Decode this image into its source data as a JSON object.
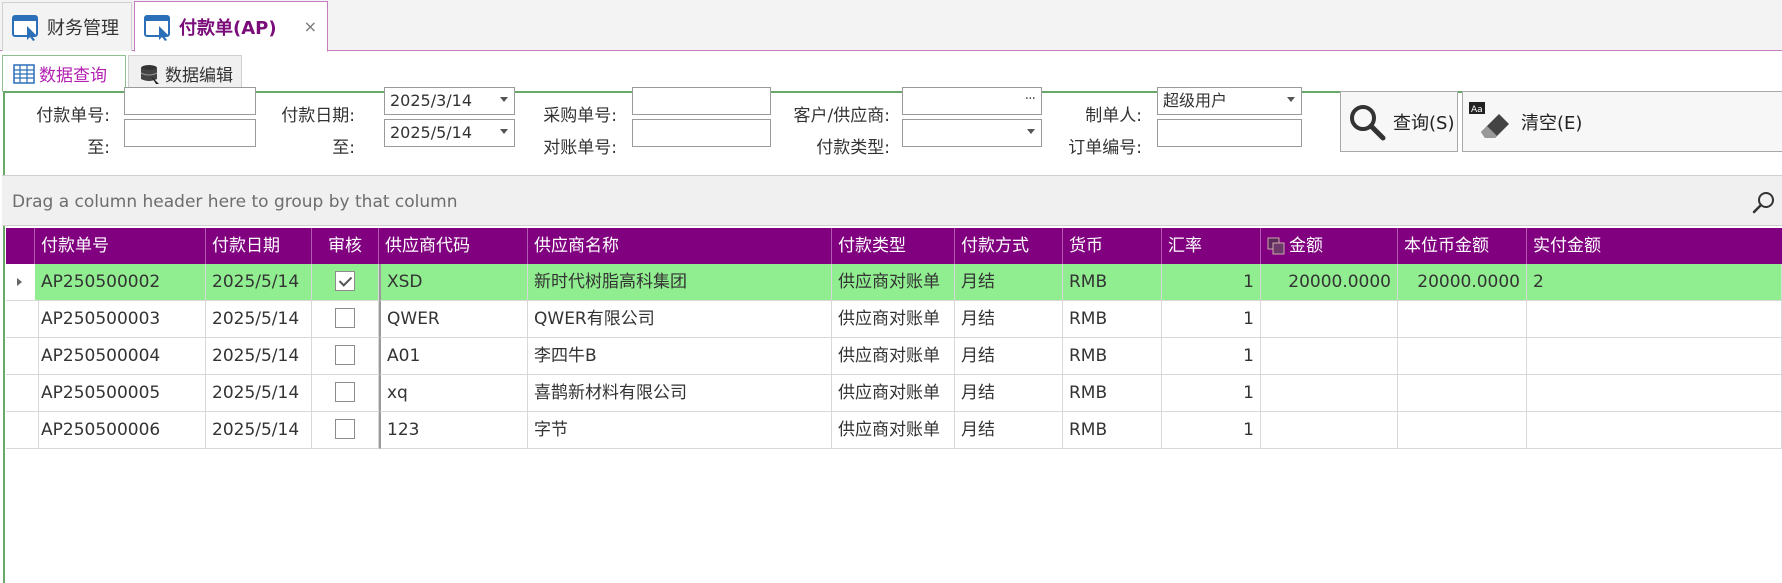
{
  "doc_tabs": [
    {
      "label": "财务管理",
      "icon": "window-pointer-icon"
    },
    {
      "label": "付款单(AP)",
      "icon": "window-pointer-icon",
      "close": "×"
    }
  ],
  "sub_tabs": [
    {
      "label": "数据查询",
      "icon": "grid-icon"
    },
    {
      "label": "数据编辑",
      "icon": "database-icon"
    }
  ],
  "filters": {
    "pay_no_label": "付款单号:",
    "pay_no_value": "",
    "pay_no_to_label": "至:",
    "pay_no_to_value": "",
    "pay_date_label": "付款日期:",
    "pay_date_from": "2025/3/14",
    "pay_date_to_label": "至:",
    "pay_date_to": "2025/5/14",
    "purchase_no_label": "采购单号:",
    "purchase_no_value": "",
    "reconcile_no_label": "对账单号:",
    "reconcile_no_value": "",
    "customer_label": "客户/供应商:",
    "customer_value": "",
    "customer_button": "···",
    "pay_type_label": "付款类型:",
    "pay_type_value": "",
    "creator_label": "制单人:",
    "creator_value": "超级用户",
    "order_no_label": "订单编号:",
    "order_no_value": ""
  },
  "buttons": {
    "query_label": "查询(S)",
    "clear_label": "清空(E)"
  },
  "group_panel_text": "Drag a column header here to group by that column",
  "columns": [
    "付款单号",
    "付款日期",
    "审核",
    "供应商代码",
    "供应商名称",
    "付款类型",
    "付款方式",
    "货币",
    "汇率",
    "金额",
    "本位币金额",
    "实付金额"
  ],
  "rows": [
    {
      "pay_no": "AP250500002",
      "date": "2025/5/14",
      "audited": true,
      "supplier_code": "XSD",
      "supplier_name": "新时代树脂高科集团",
      "pay_type": "供应商对账单",
      "pay_method": "月结",
      "currency": "RMB",
      "rate": "1",
      "amount": "20000.0000",
      "base_amount": "20000.0000",
      "paid": "2"
    },
    {
      "pay_no": "AP250500003",
      "date": "2025/5/14",
      "audited": false,
      "supplier_code": "QWER",
      "supplier_name": "QWER有限公司",
      "pay_type": "供应商对账单",
      "pay_method": "月结",
      "currency": "RMB",
      "rate": "1",
      "amount": "",
      "base_amount": "",
      "paid": ""
    },
    {
      "pay_no": "AP250500004",
      "date": "2025/5/14",
      "audited": false,
      "supplier_code": "A01",
      "supplier_name": "李四牛B",
      "pay_type": "供应商对账单",
      "pay_method": "月结",
      "currency": "RMB",
      "rate": "1",
      "amount": "",
      "base_amount": "",
      "paid": ""
    },
    {
      "pay_no": "AP250500005",
      "date": "2025/5/14",
      "audited": false,
      "supplier_code": "xq",
      "supplier_name": "喜鹊新材料有限公司",
      "pay_type": "供应商对账单",
      "pay_method": "月结",
      "currency": "RMB",
      "rate": "1",
      "amount": "",
      "base_amount": "",
      "paid": ""
    },
    {
      "pay_no": "AP250500006",
      "date": "2025/5/14",
      "audited": false,
      "supplier_code": "123",
      "supplier_name": "字节",
      "pay_type": "供应商对账单",
      "pay_method": "月结",
      "currency": "RMB",
      "rate": "1",
      "amount": "",
      "base_amount": "",
      "paid": ""
    }
  ],
  "colors": {
    "header_bg": "#800080",
    "selected_row_bg": "#90ee90",
    "accent": "#7b0d7b"
  }
}
